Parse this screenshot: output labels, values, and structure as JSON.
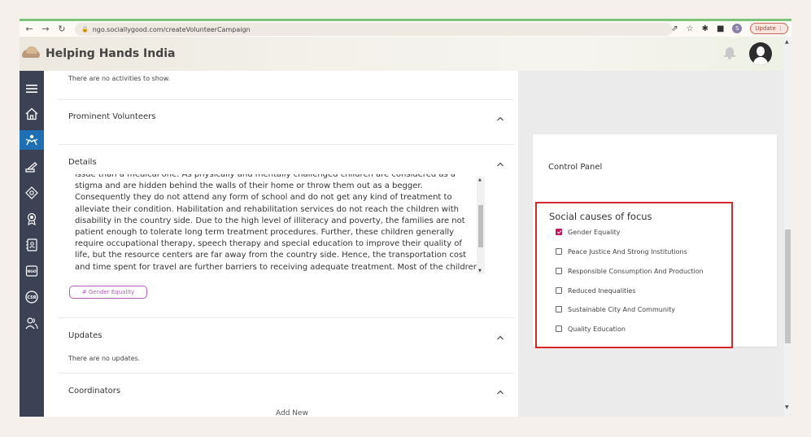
{
  "browser": {
    "url": "ngo.sociallygood.com/createVolunteerCampaign",
    "profile_initial": "S",
    "update_label": "Update"
  },
  "app": {
    "brand": "Helping Hands India"
  },
  "sidebar": {
    "items": [
      {
        "icon": "menu-icon"
      },
      {
        "icon": "home-icon"
      },
      {
        "icon": "volunteer-icon",
        "active": true
      },
      {
        "icon": "campaign-icon"
      },
      {
        "icon": "donation-icon"
      },
      {
        "icon": "award-icon"
      },
      {
        "icon": "contacts-icon"
      },
      {
        "icon": "ngo-icon",
        "text": "NGO"
      },
      {
        "icon": "csr-icon",
        "text": "CSR"
      },
      {
        "icon": "people-icon"
      }
    ]
  },
  "main": {
    "activities_empty": "There are no activities to show.",
    "prominent_volunteers_title": "Prominent Volunteers",
    "details_title": "Details",
    "details_lines": [
      "issue than a medical one. As physically and mentally challenged children are considered as a",
      "stigma and are hidden behind the walls of their home or throw them out as a begger.",
      "Consequently they do not attend any form of school and do not get any kind of treatment to",
      "alleviate their condition. Habilitation and rehabilitation services do not reach the children with",
      "disability in the country side. Due to the high level of illiteracy and poverty, the families are not",
      "patient enough to tolerate long term treatment procedures. Further, these children generally",
      "require occupational therapy, speech therapy and special education to improve their quality of",
      "life, but the resource centers are far away from the country side. Hence, the transportation cost",
      "and time spent for travel are further barriers to receiving adequate treatment. Most of the children"
    ],
    "details_tag": "# Gender Equality",
    "updates_title": "Updates",
    "updates_empty": "There are no updates.",
    "coordinators_title": "Coordinators",
    "add_new": "Add New"
  },
  "control_panel": {
    "title": "Control Panel",
    "causes_title": "Social causes of focus",
    "causes": [
      {
        "label": "Gender Equality",
        "checked": true
      },
      {
        "label": "Peace Justice And Strong Institutions",
        "checked": false
      },
      {
        "label": "Responsible Consumption And Production",
        "checked": false
      },
      {
        "label": "Reduced Inequalities",
        "checked": false
      },
      {
        "label": "Sustainable City And Community",
        "checked": false
      },
      {
        "label": "Quality Education",
        "checked": false
      }
    ]
  },
  "colors": {
    "sidebar_bg": "#3d4154",
    "sidebar_active": "#1f6fb5",
    "tag": "#b25fb8",
    "highlight_border": "#d8282b",
    "checkbox_checked": "#c2185b"
  }
}
